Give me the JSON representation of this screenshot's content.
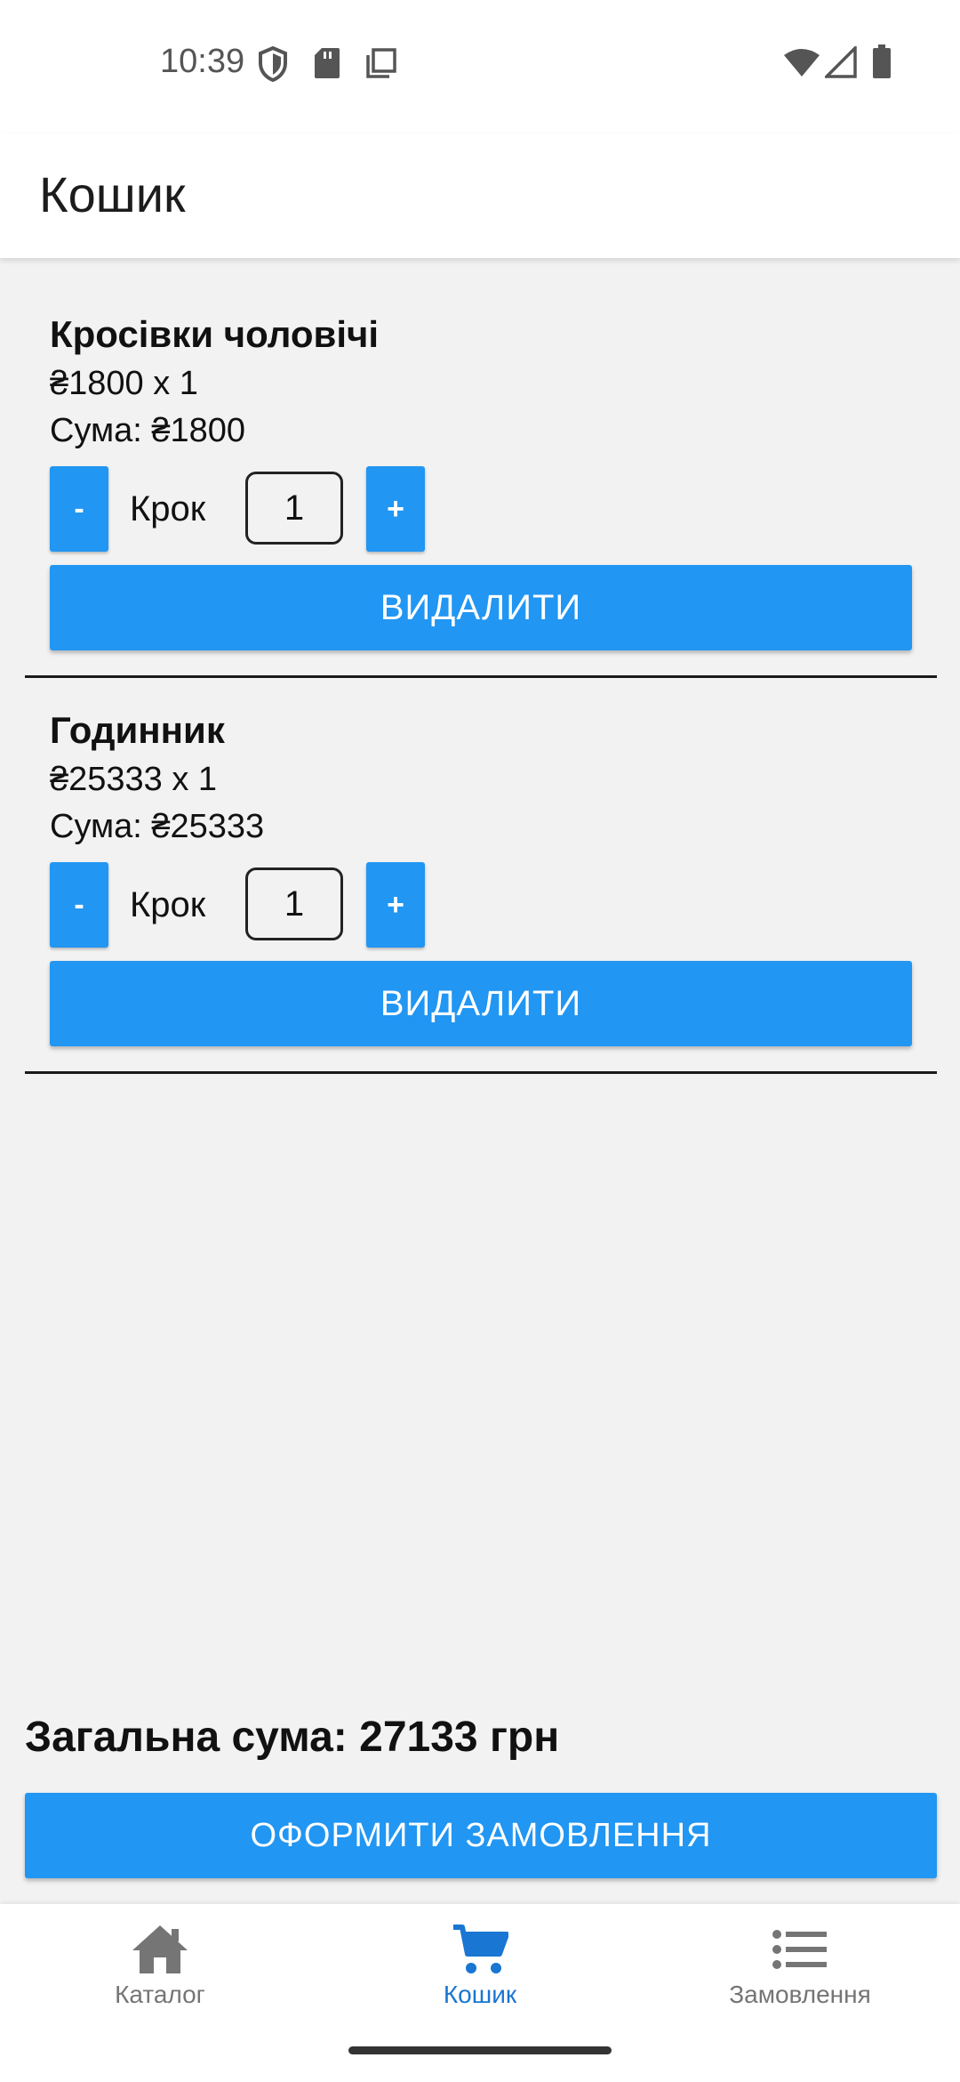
{
  "status_bar": {
    "time": "10:39"
  },
  "app_bar": {
    "title": "Кошик"
  },
  "cart": {
    "items": [
      {
        "name": "Кросівки чоловічі",
        "price_line": "₴1800 x 1",
        "sum_line": "Сума: ₴1800",
        "minus": "-",
        "step_label": "Крок",
        "quantity": "1",
        "plus": "+",
        "delete": "ВИДАЛИТИ"
      },
      {
        "name": "Годинник",
        "price_line": "₴25333 x 1",
        "sum_line": "Сума: ₴25333",
        "minus": "-",
        "step_label": "Крок",
        "quantity": "1",
        "plus": "+",
        "delete": "ВИДАЛИТИ"
      }
    ],
    "total": "Загальна сума: 27133 грн",
    "checkout": "ОФОРМИТИ ЗАМОВЛЕННЯ"
  },
  "bottom_nav": {
    "items": [
      {
        "label": "Каталог",
        "icon": "home-icon",
        "active": false
      },
      {
        "label": "Кошик",
        "icon": "cart-icon",
        "active": true
      },
      {
        "label": "Замовлення",
        "icon": "list-icon",
        "active": false
      }
    ]
  },
  "colors": {
    "accent": "#2196f3",
    "active_nav": "#1976d2",
    "inactive_nav": "#757575"
  }
}
